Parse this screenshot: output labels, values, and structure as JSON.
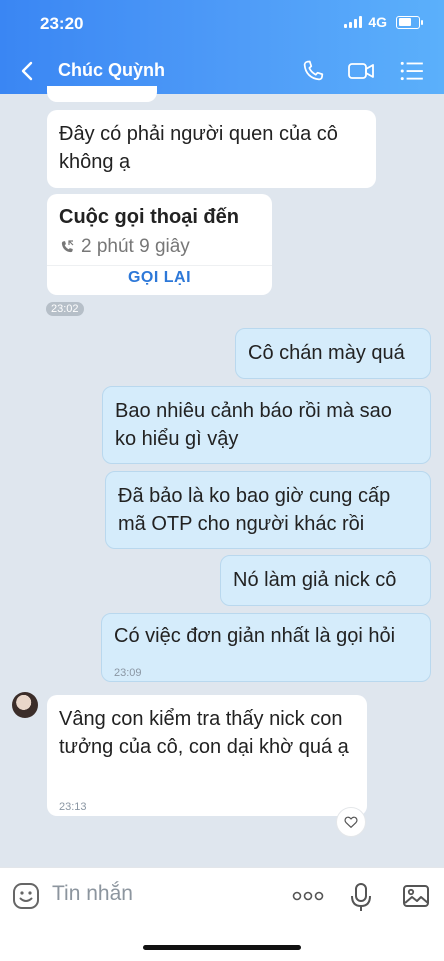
{
  "status": {
    "time": "23:20",
    "network": "4G"
  },
  "header": {
    "contact_name": "Chúc Quỳnh"
  },
  "messages": [
    {
      "side": "left",
      "text": "Đây có phải người quen của cô không ạ"
    },
    {
      "side": "right",
      "text": "Cô chán mày quá"
    },
    {
      "side": "right",
      "text": "Bao nhiêu cảnh báo rồi mà sao ko hiểu gì vậy"
    },
    {
      "side": "right",
      "text": "Đã bảo là ko bao giờ cung cấp mã OTP cho người khác rồi"
    },
    {
      "side": "right",
      "text": "Nó làm giả nick cô"
    },
    {
      "side": "right",
      "text": "Có việc đơn giản nhất là gọi hỏi",
      "time": "23:09"
    },
    {
      "side": "left",
      "text": "Vâng con kiểm tra thấy nick con tưởng của cô, con dại khờ quá ạ",
      "time": "23:13"
    }
  ],
  "call": {
    "title": "Cuộc gọi thoại đến",
    "duration": "2 phút 9 giây",
    "action": "GỌI LẠI",
    "time": "23:02"
  },
  "composer": {
    "placeholder": "Tin nhắn"
  },
  "icons": [
    "back-icon",
    "phone-icon",
    "video-icon",
    "menu-icon",
    "missed-call-icon",
    "heart-icon",
    "sticker-icon",
    "more-icon",
    "mic-icon",
    "image-icon"
  ]
}
